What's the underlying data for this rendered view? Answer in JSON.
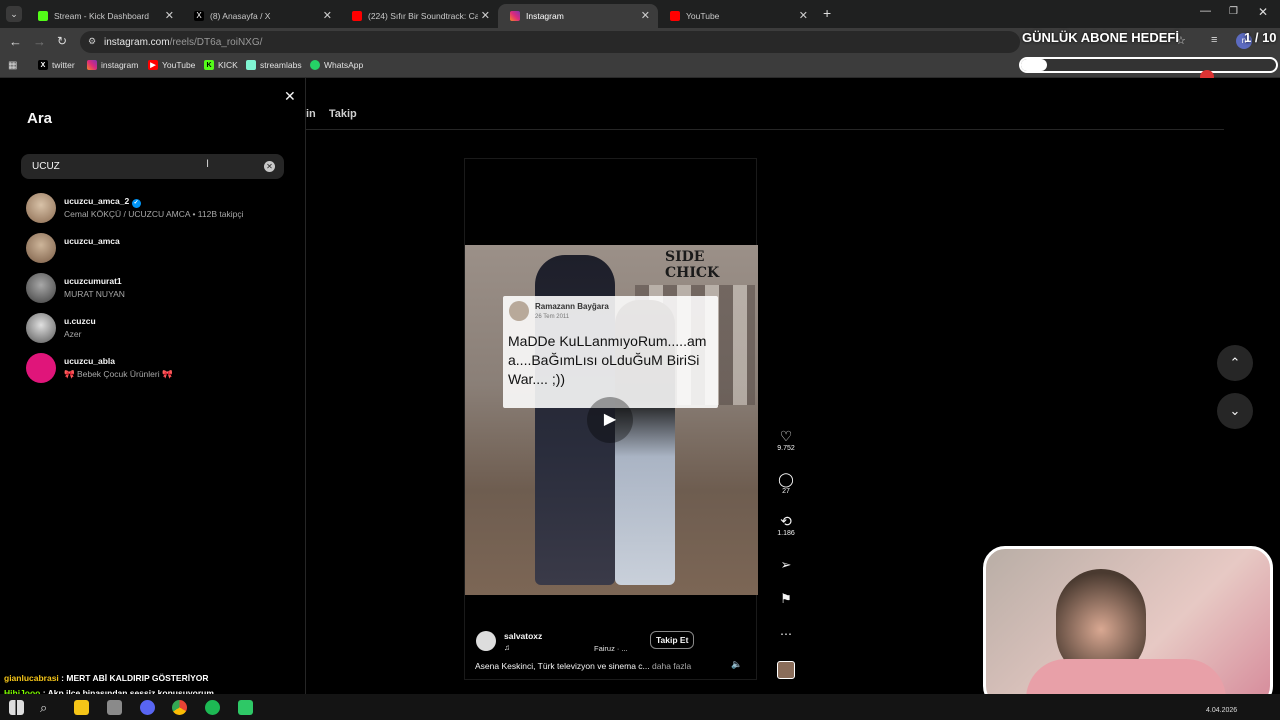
{
  "browser": {
    "tabs": [
      {
        "title": "Stream - Kick Dashboard",
        "color": "#53fc18"
      },
      {
        "title": "(8) Anasayfa / X",
        "color": "#ffffff"
      },
      {
        "title": "(224) Sıfır Bir Soundtrack: Cash",
        "color": "#ff0000"
      },
      {
        "title": "Instagram",
        "color": "#e1306c"
      },
      {
        "title": "YouTube",
        "color": "#ff0000"
      }
    ],
    "new_tab": "+",
    "url_host": "instagram.com",
    "url_path": "/reels/DT6a_roiNXG/",
    "bookmarks": [
      "twitter",
      "instagram",
      "YouTube",
      "KICK",
      "streamlabs",
      "WhatsApp"
    ]
  },
  "overlay": {
    "goal_title": "GÜNLÜK ABONE HEDEFİ",
    "goal_count": "1 / 10",
    "goal_progress": 0.1
  },
  "search": {
    "title": "Ara",
    "query": "UCUZ",
    "results": [
      {
        "username": "ucuzcu_amca_2",
        "verified": true,
        "sub": "Cemal KÖKÇÜ / UCUZCU AMCA • 112B takipçi"
      },
      {
        "username": "ucuzcu_amca",
        "verified": false,
        "sub": ""
      },
      {
        "username": "ucuzcumurat1",
        "verified": false,
        "sub": "MURAT NUYAN"
      },
      {
        "username": "u.cuzcu",
        "verified": false,
        "sub": "Azer"
      },
      {
        "username": "ucuzcu_abla",
        "verified": false,
        "sub": "🎀 Bebek Çocuk Ürünleri 🎀"
      }
    ]
  },
  "reels_tabs": {
    "partial": "in",
    "follow": "Takip"
  },
  "reel": {
    "banner": "SIDE CHICK",
    "post_author": "Ramazann Bayğara",
    "post_date": "26 Tem 2011",
    "post_text": "MaDDe KuLLanmıyoRum.....ama....BaĞımLısı oLduĞuM BiriSi War.... ;))",
    "username": "salvatoxz",
    "audio": "Fairuz · ...",
    "follow_button": "Takip Et",
    "caption": "Asena Keskinci, Türk televizyon ve sinema c...",
    "more": "daha fazla",
    "likes": "9.752",
    "comments": "27",
    "reposts": "1.186"
  },
  "chat": [
    {
      "user": "gianlucabrasi",
      "user_color": "#f5c518",
      "message": "MERT ABİ KALDIRIP GÖSTERİYOR"
    },
    {
      "user": "HihiJooo",
      "user_color": "#7fff00",
      "message": "Akp ilçe binasından sessiz konuşuyorum"
    }
  ],
  "taskbar": {
    "date": "4.04.2026"
  }
}
